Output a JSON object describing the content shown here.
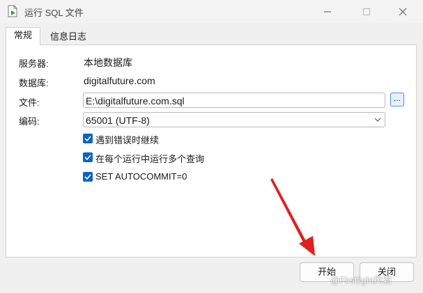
{
  "window": {
    "title": "运行 SQL 文件"
  },
  "tabs": [
    {
      "label": "常规",
      "active": true
    },
    {
      "label": "信息日志",
      "active": false
    }
  ],
  "form": {
    "server_label": "服务器:",
    "server_value": "本地数据库",
    "database_label": "数据库:",
    "database_value": "digitalfuture.com",
    "file_label": "文件:",
    "file_value": "E:\\digitalfuture.com.sql",
    "browse_label": "...",
    "encoding_label": "编码:",
    "encoding_value": "65001 (UTF-8)"
  },
  "options": [
    {
      "label": "遇到错误时继续",
      "checked": true
    },
    {
      "label": "在每个运行中运行多个查询",
      "checked": true
    },
    {
      "label": "SET AUTOCOMMIT=0",
      "checked": true
    }
  ],
  "buttons": {
    "start_label": "开始",
    "close_label": "关闭"
  },
  "watermark": "@Firstlight风君",
  "colors": {
    "accent": "#0a64c8",
    "annotation_arrow": "#e02020"
  },
  "icons": {
    "app": "run-sql-file-icon",
    "minimize": "minimize-icon",
    "maximize": "maximize-icon",
    "close": "close-icon",
    "dropdown": "chevron-down-icon",
    "checkbox": "checkmark-icon"
  }
}
